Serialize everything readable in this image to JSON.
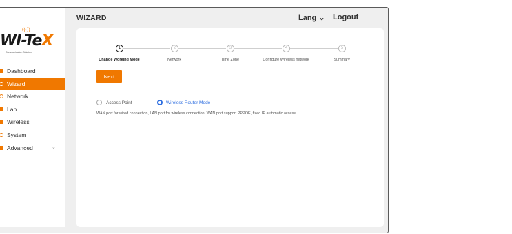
{
  "logo": {
    "text_main": "WI-Te",
    "text_x": "X",
    "tagline": "Communication Solution"
  },
  "header": {
    "title": "WIZARD",
    "lang_label": "Lang",
    "lang_chevron": "⌄",
    "logout_label": "Logout"
  },
  "sidebar": {
    "items": [
      {
        "label": "Dashboard",
        "icon": "dashboard-icon"
      },
      {
        "label": "Wizard",
        "icon": "wizard-icon",
        "active": true
      },
      {
        "label": "Network",
        "icon": "network-icon"
      },
      {
        "label": "Lan",
        "icon": "lan-icon"
      },
      {
        "label": "Wireless",
        "icon": "wireless-icon"
      },
      {
        "label": "System",
        "icon": "system-icon"
      },
      {
        "label": "Advanced",
        "icon": "advanced-icon",
        "chevron": "⌄"
      }
    ]
  },
  "wizard": {
    "steps": [
      {
        "number": "1",
        "label": "Change Working Mode",
        "current": true
      },
      {
        "number": "2",
        "label": "Network"
      },
      {
        "number": "3",
        "label": "Time Zone"
      },
      {
        "number": "4",
        "label": "Configure Wireless network"
      },
      {
        "number": "5",
        "label": "Summary"
      }
    ],
    "next_label": "Next",
    "modes": [
      {
        "label": "Access Point",
        "selected": false
      },
      {
        "label": "Wireless Router Mode",
        "selected": true
      }
    ],
    "description": "WAN port for wired connection, LAN port for wireless connection, WAN port support PPPOE, fixed IP automatic access."
  },
  "colors": {
    "accent": "#f07800",
    "selected_blue": "#2f6fe0"
  }
}
